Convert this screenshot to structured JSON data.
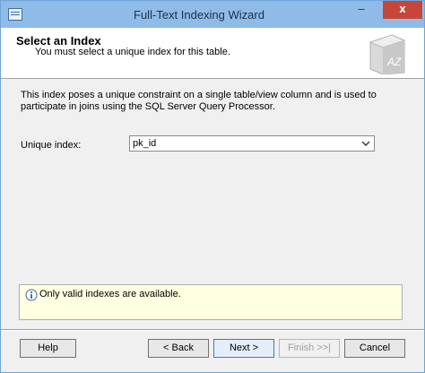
{
  "window": {
    "title": "Full-Text Indexing Wizard"
  },
  "titlebar": {
    "minimize": "–",
    "maximize": "□",
    "close": "x"
  },
  "header": {
    "title": "Select an Index",
    "subtitle": "You must select a unique index for this table.",
    "graphic_text": "AZ"
  },
  "description": "This index poses a unique constraint on a single table/view column and is used to participate in joins using the SQL Server Query Processor.",
  "unique_index": {
    "label": "Unique index:",
    "selected": "pk_id"
  },
  "info": {
    "text": "Only valid indexes are available."
  },
  "buttons": {
    "help": "Help",
    "back": "< Back",
    "next": "Next >",
    "finish": "Finish >>|",
    "cancel": "Cancel"
  },
  "colors": {
    "titlebar": "#8fbbe8",
    "close_button": "#c7463a",
    "info_background": "#ffffe1",
    "dialog_background": "#f0f0f0"
  }
}
